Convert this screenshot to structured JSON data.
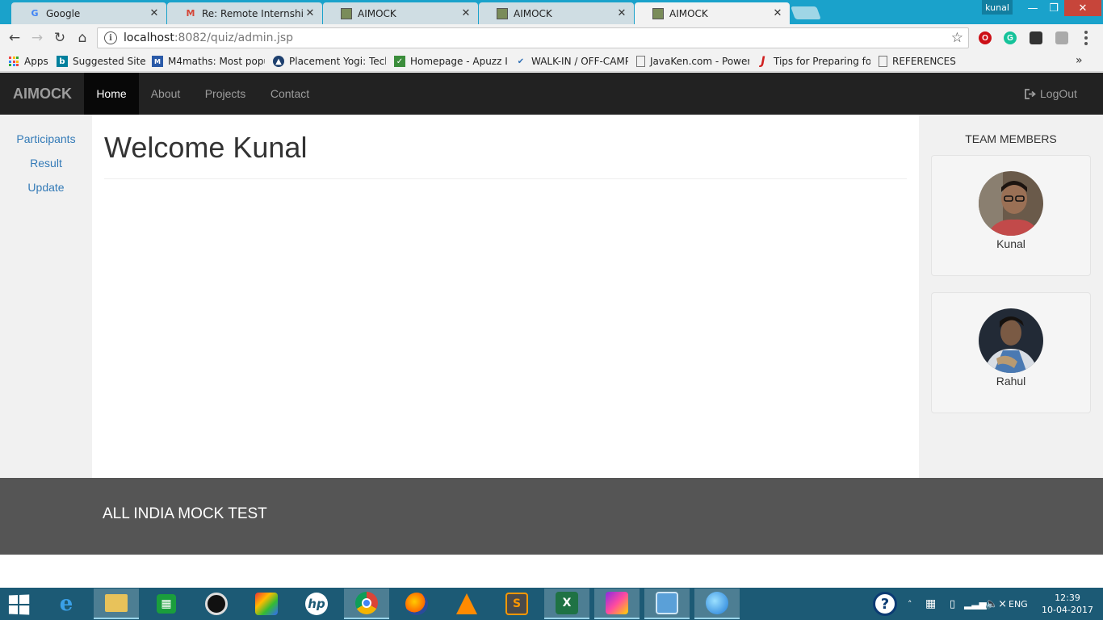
{
  "browser": {
    "tabs": [
      {
        "label": "Google",
        "icon": "google-icon"
      },
      {
        "label": "Re: Remote Internship | P",
        "icon": "gmail-icon"
      },
      {
        "label": "AIMOCK",
        "icon": "page-icon"
      },
      {
        "label": "AIMOCK",
        "icon": "page-icon"
      },
      {
        "label": "AIMOCK",
        "icon": "page-icon",
        "active": true
      }
    ],
    "tab_close": "✕",
    "profile": "kunal",
    "url_host": "localhost",
    "url_path": ":8082/quiz/admin.jsp",
    "bookmarks": [
      {
        "label": "Apps",
        "icon": "apps-grid-icon"
      },
      {
        "label": "Suggested Sites",
        "icon": "bing-icon"
      },
      {
        "label": "M4maths: Most popul",
        "icon": "m4maths-icon"
      },
      {
        "label": "Placement Yogi: Tech",
        "icon": "placement-yogi-icon"
      },
      {
        "label": "Homepage - Apuzz In",
        "icon": "apuzz-icon"
      },
      {
        "label": "WALK-IN / OFF-CAMP",
        "icon": "walkin-icon"
      },
      {
        "label": "JavaKen.com - Power",
        "icon": "page-icon"
      },
      {
        "label": "Tips for Preparing for",
        "icon": "tips-icon"
      },
      {
        "label": "REFERENCES",
        "icon": "page-icon"
      }
    ],
    "more_bookmarks": "»"
  },
  "site": {
    "brand": "AIMOCK",
    "nav": [
      {
        "label": "Home",
        "active": true
      },
      {
        "label": "About"
      },
      {
        "label": "Projects"
      },
      {
        "label": "Contact"
      }
    ],
    "logout": "LogOut",
    "sidebar": [
      "Participants",
      "Result",
      "Update"
    ],
    "welcome": "Welcome Kunal",
    "team_title": "TEAM MEMBERS",
    "members": [
      {
        "name": "Kunal"
      },
      {
        "name": "Rahul"
      }
    ],
    "footer": "ALL INDIA MOCK TEST"
  },
  "taskbar": {
    "lang": "ENG",
    "time": "12:39",
    "date": "10-04-2017",
    "help": "?"
  }
}
